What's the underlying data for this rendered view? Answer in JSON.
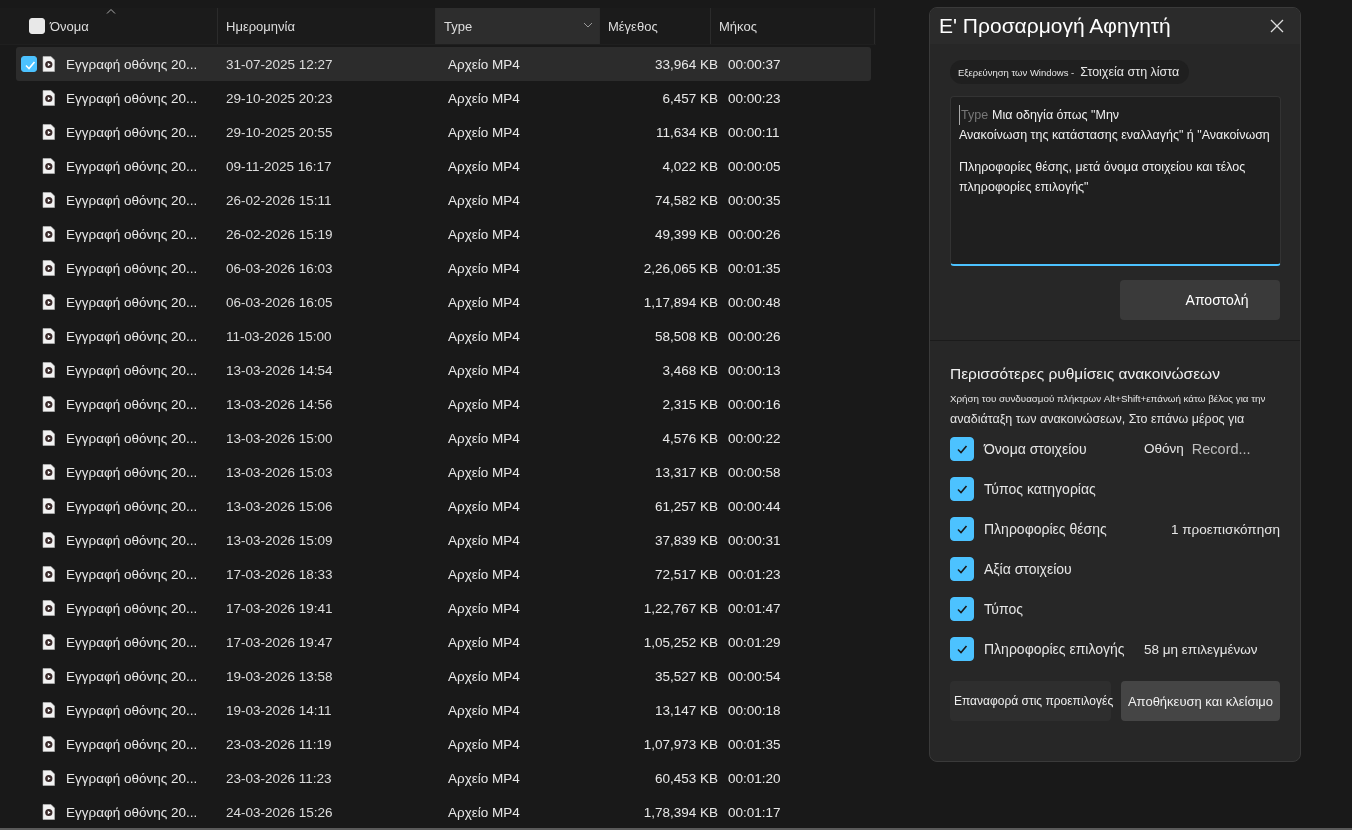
{
  "file_list": {
    "header_checkbox": {
      "checked": false
    },
    "columns": [
      {
        "label": "Όνομα",
        "sorted": true,
        "highlighted": false
      },
      {
        "label": "Ημερομηνία",
        "sorted": false,
        "highlighted": false
      },
      {
        "label": "Type",
        "sorted": false,
        "highlighted": true
      },
      {
        "label": "Μέγεθος",
        "sorted": false,
        "highlighted": false
      },
      {
        "label": "Μήκος",
        "sorted": false,
        "highlighted": false
      }
    ],
    "rows": [
      {
        "selected": true,
        "name": "Εγγραφή οθόνης 20...",
        "date": "31-07-2025 12:27",
        "type": "Αρχείο MP4",
        "size": "33,964 KB",
        "length": "00:00:37"
      },
      {
        "selected": false,
        "name": "Εγγραφή οθόνης 20...",
        "date": "29-10-2025 20:23",
        "type": "Αρχείο MP4",
        "size": "6,457 KB",
        "length": "00:00:23"
      },
      {
        "selected": false,
        "name": "Εγγραφή οθόνης 20...",
        "date": "29-10-2025 20:55",
        "type": "Αρχείο MP4",
        "size": "11,634 KB",
        "length": "00:00:11"
      },
      {
        "selected": false,
        "name": "Εγγραφή οθόνης 20...",
        "date": "09-11-2025 16:17",
        "type": "Αρχείο MP4",
        "size": "4,022 KB",
        "length": "00:00:05"
      },
      {
        "selected": false,
        "name": "Εγγραφή οθόνης 20...",
        "date": "26-02-2026 15:11",
        "type": "Αρχείο MP4",
        "size": "74,582 KB",
        "length": "00:00:35"
      },
      {
        "selected": false,
        "name": "Εγγραφή οθόνης 20...",
        "date": "26-02-2026 15:19",
        "type": "Αρχείο MP4",
        "size": "49,399 KB",
        "length": "00:00:26"
      },
      {
        "selected": false,
        "name": "Εγγραφή οθόνης 20...",
        "date": "06-03-2026 16:03",
        "type": "Αρχείο MP4",
        "size": "2,26,065 KB",
        "length": "00:01:35"
      },
      {
        "selected": false,
        "name": "Εγγραφή οθόνης 20...",
        "date": "06-03-2026 16:05",
        "type": "Αρχείο MP4",
        "size": "1,17,894 KB",
        "length": "00:00:48"
      },
      {
        "selected": false,
        "name": "Εγγραφή οθόνης 20...",
        "date": "11-03-2026 15:00",
        "type": "Αρχείο MP4",
        "size": "58,508 KB",
        "length": "00:00:26"
      },
      {
        "selected": false,
        "name": "Εγγραφή οθόνης 20...",
        "date": "13-03-2026 14:54",
        "type": "Αρχείο MP4",
        "size": "3,468 KB",
        "length": "00:00:13"
      },
      {
        "selected": false,
        "name": "Εγγραφή οθόνης 20...",
        "date": "13-03-2026 14:56",
        "type": "Αρχείο MP4",
        "size": "2,315 KB",
        "length": "00:00:16"
      },
      {
        "selected": false,
        "name": "Εγγραφή οθόνης 20...",
        "date": "13-03-2026 15:00",
        "type": "Αρχείο MP4",
        "size": "4,576 KB",
        "length": "00:00:22"
      },
      {
        "selected": false,
        "name": "Εγγραφή οθόνης 20...",
        "date": "13-03-2026 15:03",
        "type": "Αρχείο MP4",
        "size": "13,317 KB",
        "length": "00:00:58"
      },
      {
        "selected": false,
        "name": "Εγγραφή οθόνης 20...",
        "date": "13-03-2026 15:06",
        "type": "Αρχείο MP4",
        "size": "61,257 KB",
        "length": "00:00:44"
      },
      {
        "selected": false,
        "name": "Εγγραφή οθόνης 20...",
        "date": "13-03-2026 15:09",
        "type": "Αρχείο MP4",
        "size": "37,839 KB",
        "length": "00:00:31"
      },
      {
        "selected": false,
        "name": "Εγγραφή οθόνης 20...",
        "date": "17-03-2026 18:33",
        "type": "Αρχείο MP4",
        "size": "72,517 KB",
        "length": "00:01:23"
      },
      {
        "selected": false,
        "name": "Εγγραφή οθόνης 20...",
        "date": "17-03-2026 19:41",
        "type": "Αρχείο MP4",
        "size": "1,22,767 KB",
        "length": "00:01:47"
      },
      {
        "selected": false,
        "name": "Εγγραφή οθόνης 20...",
        "date": "17-03-2026 19:47",
        "type": "Αρχείο MP4",
        "size": "1,05,252 KB",
        "length": "00:01:29"
      },
      {
        "selected": false,
        "name": "Εγγραφή οθόνης 20...",
        "date": "19-03-2026 13:58",
        "type": "Αρχείο MP4",
        "size": "35,527 KB",
        "length": "00:00:54"
      },
      {
        "selected": false,
        "name": "Εγγραφή οθόνης 20...",
        "date": "19-03-2026 14:11",
        "type": "Αρχείο MP4",
        "size": "13,147 KB",
        "length": "00:00:18"
      },
      {
        "selected": false,
        "name": "Εγγραφή οθόνης 20...",
        "date": "23-03-2026 11:19",
        "type": "Αρχείο MP4",
        "size": "1,07,973 KB",
        "length": "00:01:35"
      },
      {
        "selected": false,
        "name": "Εγγραφή οθόνης 20...",
        "date": "23-03-2026 11:23",
        "type": "Αρχείο MP4",
        "size": "60,453 KB",
        "length": "00:01:20"
      },
      {
        "selected": false,
        "name": "Εγγραφή οθόνης 20...",
        "date": "24-03-2026 15:26",
        "type": "Αρχείο MP4",
        "size": "1,78,394 KB",
        "length": "00:01:17"
      }
    ]
  },
  "dialog": {
    "title": "Ε' Προσαρμογή Αφηγητή",
    "breadcrumb": {
      "source": "Εξερεύνηση των Windows -",
      "context": "Στοιχεία στη λίστα"
    },
    "instruction_field": {
      "placeholder": "Type",
      "value_lines": [
        "Μια οδηγία όπως \"Μην",
        "Ανακοίνωση της κατάστασης εναλλαγής\" ή \"Ανακοίνωση",
        "Πληροφορίες θέσης, μετά όνομα στοιχείου και τέλος πληροφορίες επιλογής\""
      ]
    },
    "send_button": "Αποστολή",
    "section_title": "Περισσότερες ρυθμίσεις ανακοινώσεων",
    "hint_lines": [
      "Χρήση του συνδυασμού πλήκτρων Alt+Shift+επάνωή κάτω βέλος για την",
      "αναδιάταξη των ανακοινώσεων, Στο επάνω μέρος για"
    ],
    "options": [
      {
        "label": "Όνομα στοιχείου",
        "checked": true,
        "preview": [
          "Οθόνη",
          "Record..."
        ]
      },
      {
        "label": "Τύπος κατηγορίας",
        "checked": true
      },
      {
        "label": "Πληροφορίες θέσης",
        "checked": true,
        "preview": [
          "1 προεπισκόπηση"
        ]
      },
      {
        "label": "Αξία στοιχείου",
        "checked": true
      },
      {
        "label": "Τύπος",
        "checked": true
      },
      {
        "label": "Πληροφορίες επιλογής",
        "checked": true,
        "preview": [
          "58 μη επιλεγμένων"
        ]
      }
    ],
    "buttons": [
      {
        "label": "Επαναφορά στις προεπιλογές",
        "kind": "secondary"
      },
      {
        "label": "Αποθήκευση και κλείσιμο",
        "kind": "primary"
      }
    ]
  }
}
